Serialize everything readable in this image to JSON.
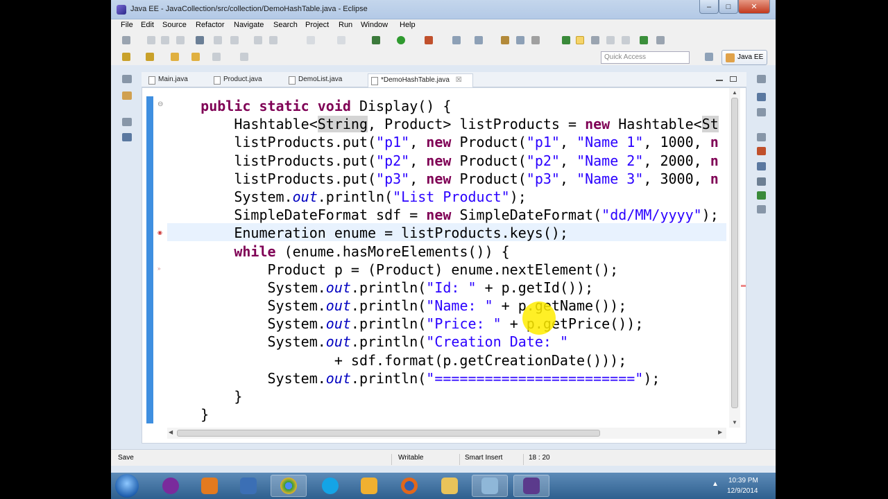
{
  "window": {
    "title": "Java EE - JavaCollection/src/collection/DemoHashTable.java - Eclipse",
    "min_glyph": "–",
    "max_glyph": "□",
    "close_glyph": "✕"
  },
  "menu": [
    "File",
    "Edit",
    "Source",
    "Refactor",
    "Navigate",
    "Search",
    "Project",
    "Run",
    "Window",
    "Help"
  ],
  "toolbar": {
    "quick_access_placeholder": "Quick Access",
    "perspective_label": "Java EE"
  },
  "editor_tabs": [
    {
      "label": "Main.java",
      "active": false
    },
    {
      "label": "Product.java",
      "active": false
    },
    {
      "label": "DemoList.java",
      "active": false
    },
    {
      "label": "*DemoHashTable.java",
      "active": true,
      "close": "☒"
    }
  ],
  "code": {
    "lines": [
      [
        [
          "    ",
          ""
        ],
        [
          "public static void",
          "kw"
        ],
        [
          " Display() {",
          ""
        ]
      ],
      [
        [
          "        Hashtable<",
          ""
        ],
        [
          "String",
          "occ"
        ],
        [
          ", Product> listProducts = ",
          ""
        ],
        [
          "new",
          "kw"
        ],
        [
          " Hashtable<",
          ""
        ],
        [
          "St",
          "occ"
        ]
      ],
      [
        [
          "        listProducts.put(",
          ""
        ],
        [
          "\"p1\"",
          "str"
        ],
        [
          ", ",
          ""
        ],
        [
          "new",
          "kw"
        ],
        [
          " Product(",
          ""
        ],
        [
          "\"p1\"",
          "str"
        ],
        [
          ", ",
          ""
        ],
        [
          "\"Name 1\"",
          "str"
        ],
        [
          ", 1000, ",
          ""
        ],
        [
          "n",
          "kw"
        ]
      ],
      [
        [
          "        listProducts.put(",
          ""
        ],
        [
          "\"p2\"",
          "str"
        ],
        [
          ", ",
          ""
        ],
        [
          "new",
          "kw"
        ],
        [
          " Product(",
          ""
        ],
        [
          "\"p2\"",
          "str"
        ],
        [
          ", ",
          ""
        ],
        [
          "\"Name 2\"",
          "str"
        ],
        [
          ", 2000, ",
          ""
        ],
        [
          "n",
          "kw"
        ]
      ],
      [
        [
          "        listProducts.put(",
          ""
        ],
        [
          "\"p3\"",
          "str"
        ],
        [
          ", ",
          ""
        ],
        [
          "new",
          "kw"
        ],
        [
          " Product(",
          ""
        ],
        [
          "\"p3\"",
          "str"
        ],
        [
          ", ",
          ""
        ],
        [
          "\"Name 3\"",
          "str"
        ],
        [
          ", 3000, ",
          ""
        ],
        [
          "n",
          "kw"
        ]
      ],
      [
        [
          "        System.",
          ""
        ],
        [
          "out",
          "it"
        ],
        [
          ".println(",
          ""
        ],
        [
          "\"List Product\"",
          "str"
        ],
        [
          ");",
          ""
        ]
      ],
      [
        [
          "        SimpleDateFormat sdf = ",
          ""
        ],
        [
          "new",
          "kw"
        ],
        [
          " SimpleDateFormat(",
          ""
        ],
        [
          "\"dd/MM/yyyy\"",
          "str"
        ],
        [
          ");",
          ""
        ]
      ],
      [
        [
          "        Enumeration enume = listProducts.keys();",
          ""
        ]
      ],
      [
        [
          "        ",
          ""
        ],
        [
          "while",
          "kw"
        ],
        [
          " (enume.hasMoreElements()) {",
          ""
        ]
      ],
      [
        [
          "            Product p = (Product) enume.nextElement();",
          ""
        ]
      ],
      [
        [
          "            System.",
          ""
        ],
        [
          "out",
          "it"
        ],
        [
          ".println(",
          ""
        ],
        [
          "\"Id: \"",
          "str"
        ],
        [
          " + p.getId());",
          ""
        ]
      ],
      [
        [
          "            System.",
          ""
        ],
        [
          "out",
          "it"
        ],
        [
          ".println(",
          ""
        ],
        [
          "\"Name: \"",
          "str"
        ],
        [
          " + p.getName());",
          ""
        ]
      ],
      [
        [
          "            System.",
          ""
        ],
        [
          "out",
          "it"
        ],
        [
          ".println(",
          ""
        ],
        [
          "\"Price: \"",
          "str"
        ],
        [
          " + p.getPrice());",
          ""
        ]
      ],
      [
        [
          "            System.",
          ""
        ],
        [
          "out",
          "it"
        ],
        [
          ".println(",
          ""
        ],
        [
          "\"Creation Date: \"",
          "str"
        ]
      ],
      [
        [
          "                    + sdf.format(p.getCreationDate()));",
          ""
        ]
      ],
      [
        [
          "            System.",
          ""
        ],
        [
          "out",
          "it"
        ],
        [
          ".println(",
          ""
        ],
        [
          "\"========================\"",
          "str"
        ],
        [
          ");",
          ""
        ]
      ],
      [
        [
          "        }",
          ""
        ]
      ],
      [
        [
          "    }",
          ""
        ]
      ]
    ]
  },
  "status": {
    "left": "Save",
    "mode": "Writable",
    "insert": "Smart Insert",
    "position": "18 : 20"
  },
  "tray": {
    "time": "10:39 PM",
    "date": "12/9/2014"
  },
  "taskbar_apps": [
    {
      "name": "yahoo-messenger-icon",
      "color": "#7a2b9c",
      "active": false
    },
    {
      "name": "media-player-icon",
      "color": "#e37a1f",
      "active": false
    },
    {
      "name": "network-icon",
      "color": "#3b6fb5",
      "active": false
    },
    {
      "name": "chrome-icon",
      "color": "#2e9a3e",
      "active": true
    },
    {
      "name": "skype-icon",
      "color": "#14a4e6",
      "active": false
    },
    {
      "name": "messenger-icon",
      "color": "#f0b030",
      "active": false
    },
    {
      "name": "firefox-icon",
      "color": "#e2671b",
      "active": false
    },
    {
      "name": "explorer-icon",
      "color": "#e9c35a",
      "active": false
    },
    {
      "name": "window-app-icon",
      "color": "#8fb7d8",
      "active": true
    },
    {
      "name": "eclipse-icon",
      "color": "#5b3a8c",
      "active": true
    }
  ],
  "colors": {
    "keyword": "#7f0055",
    "string": "#2a00ff",
    "field": "#0000c0",
    "current_line": "#e8f2fe",
    "cursor_highlight": "#ffec00"
  }
}
